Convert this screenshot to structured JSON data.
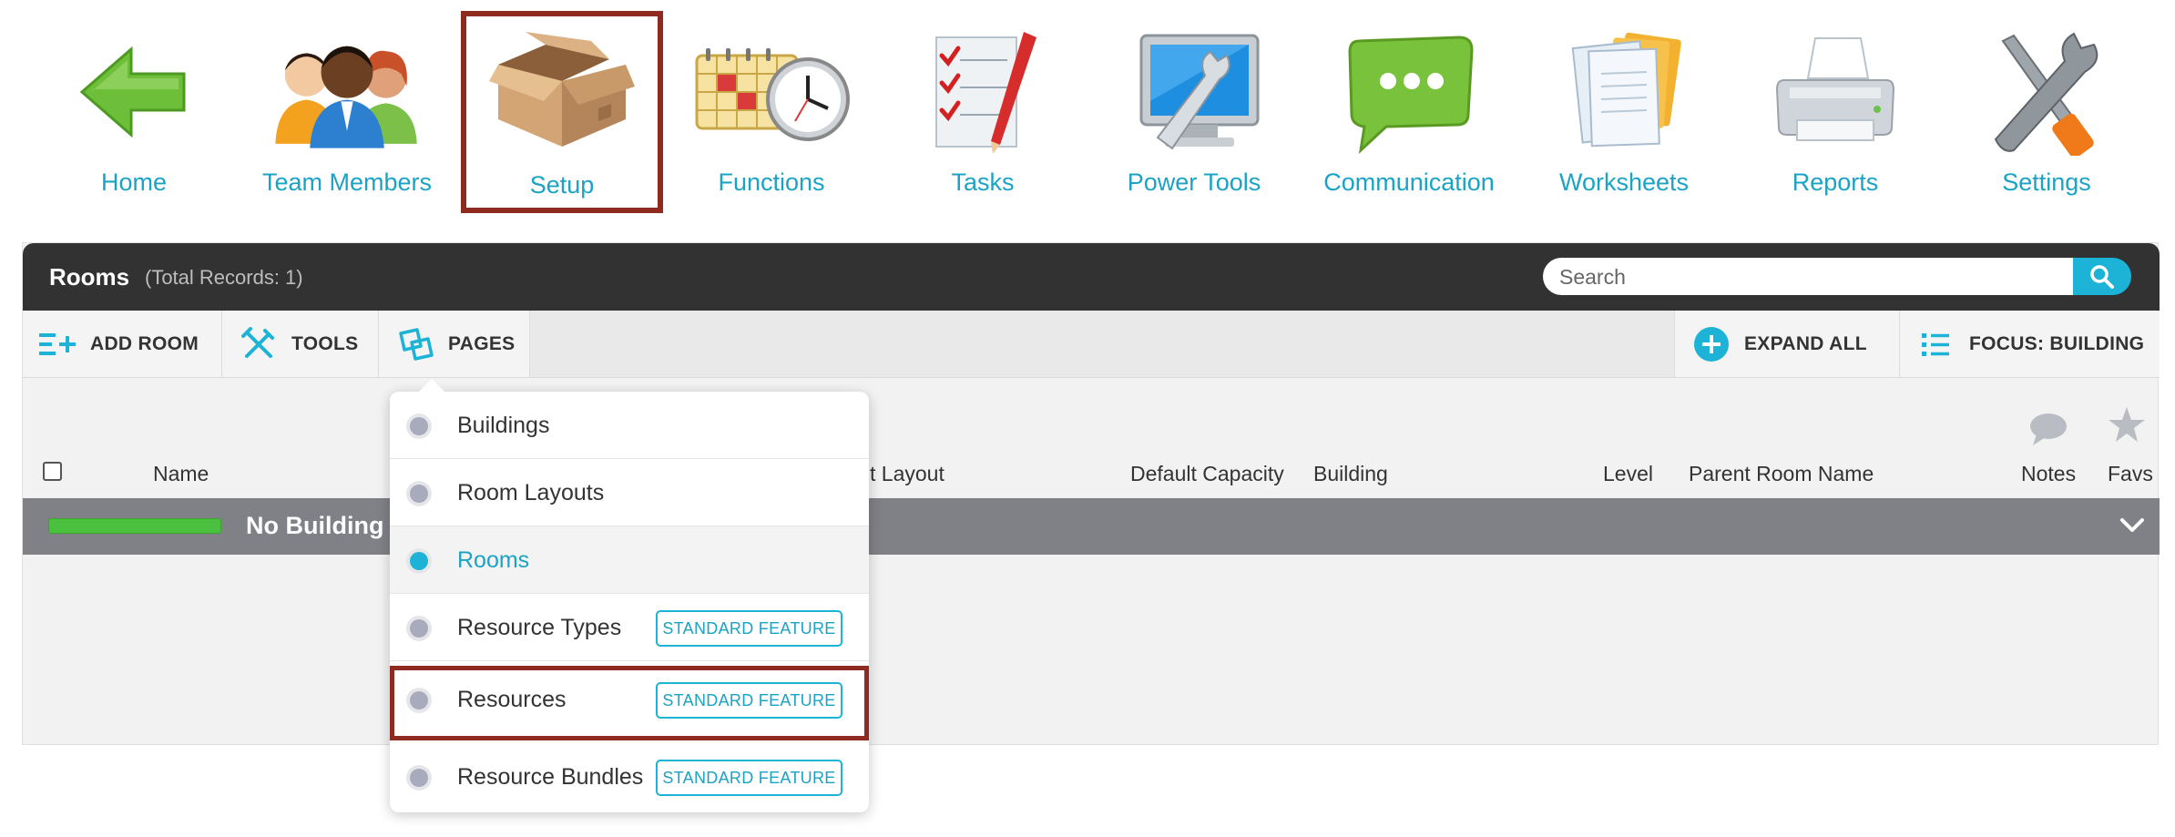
{
  "nav": {
    "items": [
      {
        "label": "Home",
        "icon": "back-arrow-icon"
      },
      {
        "label": "Team Members",
        "icon": "team-icon"
      },
      {
        "label": "Setup",
        "icon": "box-icon",
        "selected": true
      },
      {
        "label": "Functions",
        "icon": "calendar-clock-icon"
      },
      {
        "label": "Tasks",
        "icon": "checklist-icon"
      },
      {
        "label": "Power Tools",
        "icon": "monitor-wrench-icon"
      },
      {
        "label": "Communication",
        "icon": "chat-bubble-icon"
      },
      {
        "label": "Worksheets",
        "icon": "documents-icon"
      },
      {
        "label": "Reports",
        "icon": "printer-icon"
      },
      {
        "label": "Settings",
        "icon": "tools-icon"
      }
    ]
  },
  "panel": {
    "title": "Rooms",
    "count": "(Total Records: 1)",
    "search_placeholder": "Search"
  },
  "toolbar": {
    "add_room": "ADD ROOM",
    "tools": "TOOLS",
    "pages": "PAGES",
    "expand_all": "EXPAND ALL",
    "focus": "FOCUS: BUILDING"
  },
  "columns": {
    "name": "Name",
    "layout": "t Layout",
    "capacity": "Default Capacity",
    "building": "Building",
    "level": "Level",
    "parent": "Parent Room Name",
    "notes": "Notes",
    "favs": "Favs"
  },
  "group": {
    "name": "No Building A"
  },
  "dropdown": {
    "items": [
      {
        "label": "Buildings"
      },
      {
        "label": "Room Layouts"
      },
      {
        "label": "Rooms",
        "active": true
      },
      {
        "label": "Resource Types",
        "badge": "STANDARD FEATURE"
      },
      {
        "label": "Resources",
        "badge": "STANDARD FEATURE",
        "highlight": true
      },
      {
        "label": "Resource Bundles",
        "badge": "STANDARD FEATURE"
      }
    ]
  },
  "colors": {
    "accent": "#1cb3d6",
    "link": "#1ba3c5",
    "header_bg": "#323232",
    "highlight_border": "#8e2a20",
    "group_bg": "#7f8186",
    "progress": "#4bbf3e"
  }
}
